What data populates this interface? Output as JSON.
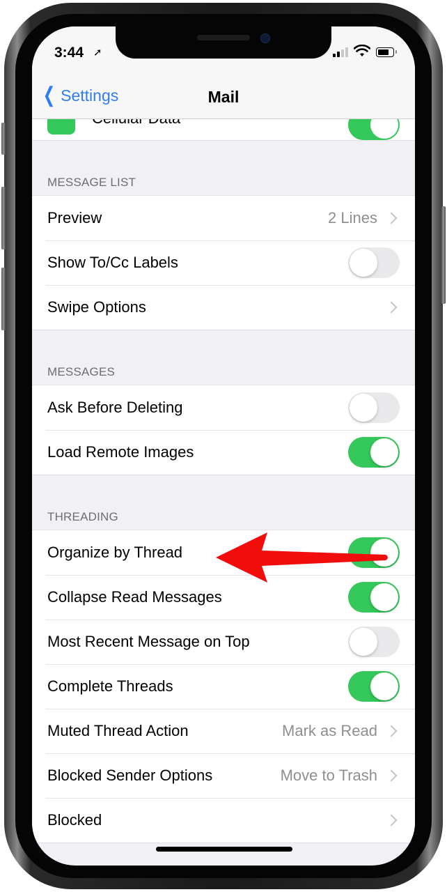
{
  "status_bar": {
    "time": "3:44",
    "location_icon": "location-arrow-icon",
    "signal_icon": "cellular-signal-icon",
    "wifi_icon": "wifi-icon",
    "battery_icon": "battery-icon"
  },
  "nav": {
    "back_label": "Settings",
    "back_icon": "chevron-left-icon",
    "title": "Mail"
  },
  "partial_row": {
    "label": "Cellular Data",
    "toggle_on": true
  },
  "sections": [
    {
      "header": "MESSAGE LIST",
      "rows": [
        {
          "label": "Preview",
          "type": "disclosure",
          "value": "2 Lines"
        },
        {
          "label": "Show To/Cc Labels",
          "type": "toggle",
          "on": false
        },
        {
          "label": "Swipe Options",
          "type": "disclosure",
          "value": ""
        }
      ]
    },
    {
      "header": "MESSAGES",
      "rows": [
        {
          "label": "Ask Before Deleting",
          "type": "toggle",
          "on": false
        },
        {
          "label": "Load Remote Images",
          "type": "toggle",
          "on": true
        }
      ]
    },
    {
      "header": "THREADING",
      "rows": [
        {
          "label": "Organize by Thread",
          "type": "toggle",
          "on": true
        },
        {
          "label": "Collapse Read Messages",
          "type": "toggle",
          "on": true
        },
        {
          "label": "Most Recent Message on Top",
          "type": "toggle",
          "on": false
        },
        {
          "label": "Complete Threads",
          "type": "toggle",
          "on": true
        },
        {
          "label": "Muted Thread Action",
          "type": "disclosure",
          "value": "Mark as Read"
        },
        {
          "label": "Blocked Sender Options",
          "type": "disclosure",
          "value": "Move to Trash"
        },
        {
          "label": "Blocked",
          "type": "disclosure",
          "value": ""
        }
      ]
    }
  ],
  "annotation": {
    "icon": "red-arrow-icon",
    "color": "#f20d0d",
    "points_to": "Organize by Thread"
  },
  "colors": {
    "accent": "#2f7cf6",
    "toggle_on": "#34c759",
    "toggle_off": "#e9e9eb"
  }
}
